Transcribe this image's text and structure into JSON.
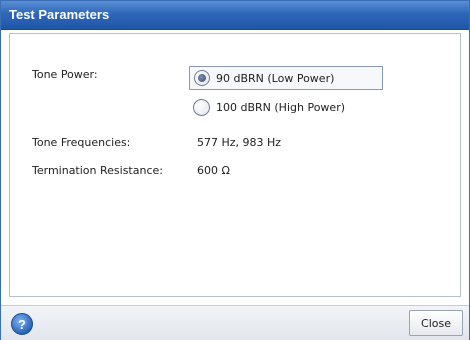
{
  "dialog": {
    "title": "Test Parameters"
  },
  "tone_power": {
    "label": "Tone Power:",
    "options": [
      {
        "label": "90 dBRN (Low Power)",
        "selected": true
      },
      {
        "label": "100 dBRN (High Power)",
        "selected": false
      }
    ]
  },
  "tone_frequencies": {
    "label": "Tone Frequencies:",
    "value": "577 Hz, 983 Hz"
  },
  "termination_resistance": {
    "label": "Termination Resistance:",
    "value": "600 Ω"
  },
  "footer": {
    "help_icon": "help-icon",
    "help_glyph": "?",
    "close_label": "Close"
  }
}
